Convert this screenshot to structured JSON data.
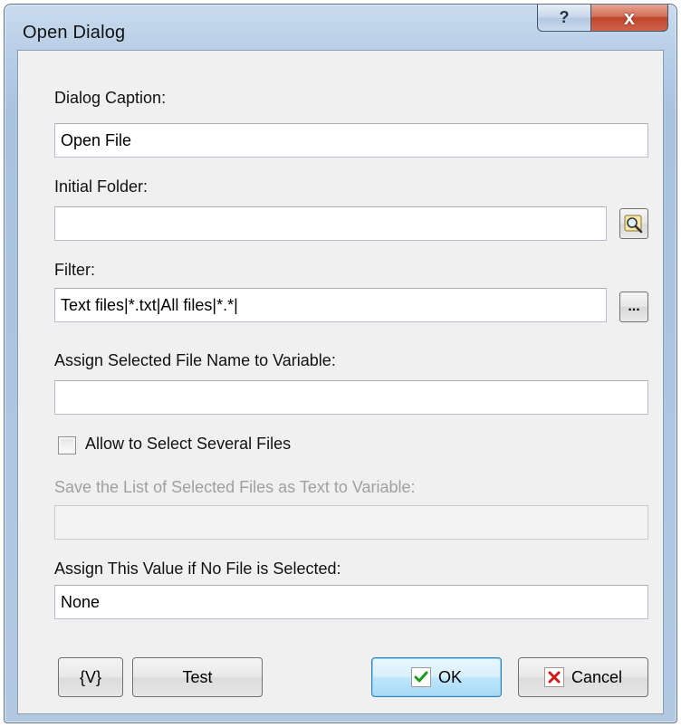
{
  "window": {
    "title": "Open Dialog",
    "help_label": "?",
    "close_label": "x"
  },
  "form": {
    "dialog_caption_label": "Dialog Caption:",
    "dialog_caption_value": "Open File",
    "initial_folder_label": "Initial Folder:",
    "initial_folder_value": "",
    "filter_label": "Filter:",
    "filter_value": "Text files|*.txt|All files|*.*|",
    "filter_browse_label": "...",
    "assign_variable_label": "Assign Selected File Name to Variable:",
    "assign_variable_value": "",
    "allow_several_label": "Allow to Select Several Files",
    "allow_several_checked": false,
    "save_list_label": "Save the List of Selected Files as Text to Variable:",
    "save_list_value": "",
    "no_file_label": "Assign This Value if No File is Selected:",
    "no_file_value": "None"
  },
  "buttons": {
    "variables_label": "{V}",
    "test_label": "Test",
    "ok_label": "OK",
    "cancel_label": "Cancel"
  },
  "icons": {
    "browse_folder": "folder-search-icon",
    "ok": "check-icon",
    "cancel": "x-icon"
  },
  "colors": {
    "ok_check": "#1a9b1a",
    "cancel_x": "#d21818",
    "close_button": "#c0442c"
  }
}
